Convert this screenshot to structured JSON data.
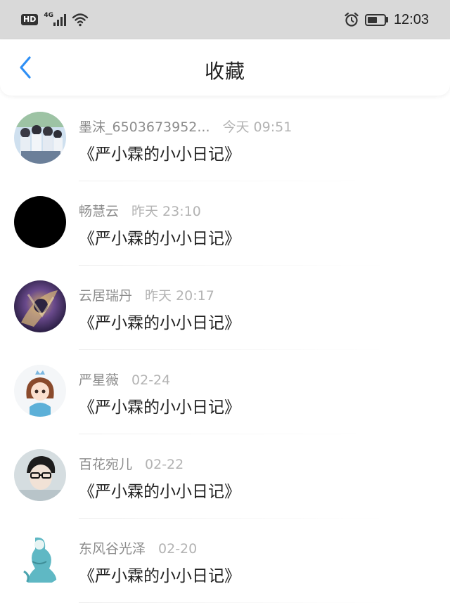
{
  "status_bar": {
    "hd": "HD",
    "network": "4G",
    "time": "12:03",
    "icons": [
      "signal-icon",
      "wifi-icon",
      "alarm-icon",
      "battery-icon"
    ]
  },
  "nav": {
    "title": "收藏",
    "back_icon": "chevron-left-icon",
    "accent": "#2e8ff5"
  },
  "items": [
    {
      "name": "墨沫_6503673952...",
      "time": "今天 09:51",
      "title": "《严小霖的小小日记》",
      "avatar": "group-photo"
    },
    {
      "name": "畅慧云",
      "time": "昨天 23:10",
      "title": "《严小霖的小小日记》",
      "avatar": "black-circle"
    },
    {
      "name": "云居瑞丹",
      "time": "昨天 20:17",
      "title": "《严小霖的小小日记》",
      "avatar": "game-character"
    },
    {
      "name": "严星薇",
      "time": "02-24",
      "title": "《严小霖的小小日记》",
      "avatar": "cartoon-girl"
    },
    {
      "name": "百花宛儿",
      "time": "02-22",
      "title": "《严小霖的小小日记》",
      "avatar": "glasses-person"
    },
    {
      "name": "东风谷光泽",
      "time": "02-20",
      "title": "《严小霖的小小日记》",
      "avatar": "teal-figure"
    }
  ]
}
